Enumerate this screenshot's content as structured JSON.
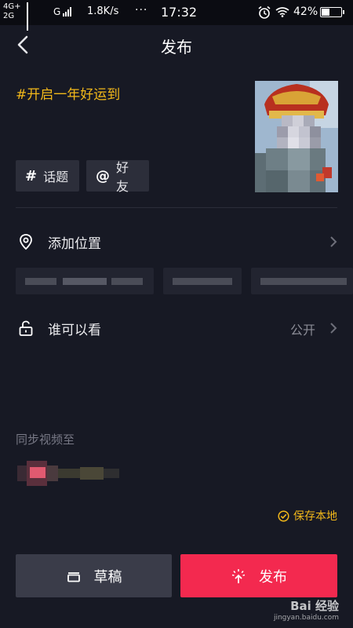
{
  "status_bar": {
    "network_top": "4G+",
    "network_bottom": "2G",
    "carrier": "G",
    "speed": "1.8K/s",
    "more": "···",
    "time": "17:32",
    "battery_percent": "42%"
  },
  "header": {
    "title": "发布",
    "back_icon": "chevron-left-icon"
  },
  "post": {
    "caption": "#开启一年好运到",
    "thumbnail": "video-cover-thumbnail"
  },
  "chips": {
    "topic": {
      "symbol": "#",
      "label": "话题"
    },
    "friend": {
      "symbol": "@",
      "label": "好友"
    }
  },
  "location": {
    "label": "添加位置",
    "icon": "location-pin-icon",
    "suggestions_visible": 3
  },
  "visibility": {
    "label": "谁可以看",
    "value": "公开",
    "icon": "unlock-icon"
  },
  "sync": {
    "label": "同步视频至",
    "account_icon": "synced-account-avatar"
  },
  "save_local": {
    "label": "保存本地",
    "icon": "check-circle-icon"
  },
  "actions": {
    "draft_label": "草稿",
    "publish_label": "发布"
  },
  "watermark": {
    "text": "Bai 经验",
    "url": "jingyan.baidu.com"
  },
  "colors": {
    "background": "#171924",
    "accent_yellow": "#f2b81a",
    "publish_red": "#f3294f",
    "chip_bg": "#2c2e3a"
  }
}
